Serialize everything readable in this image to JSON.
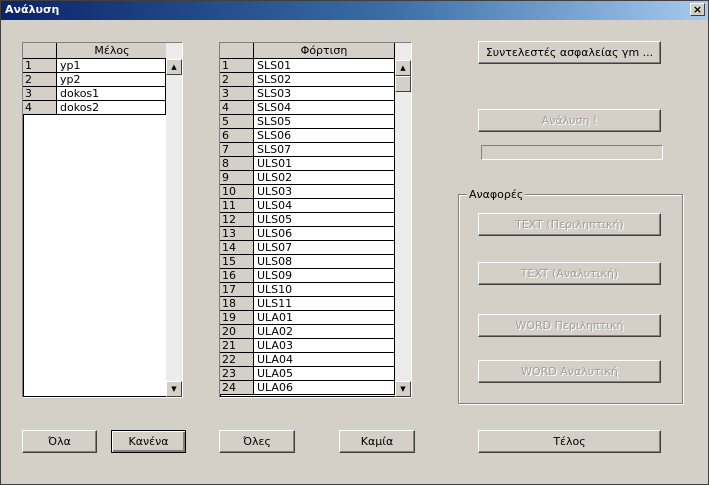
{
  "window": {
    "title": "Ανάλυση",
    "close_label": "×"
  },
  "members": {
    "header": "Μέλος",
    "rows": [
      {
        "num": "1",
        "name": "yp1"
      },
      {
        "num": "2",
        "name": "yp2"
      },
      {
        "num": "3",
        "name": "dokos1"
      },
      {
        "num": "4",
        "name": "dokos2"
      }
    ],
    "btn_all": "Όλα",
    "btn_none": "Κανένα"
  },
  "loads": {
    "header": "Φόρτιση",
    "rows": [
      {
        "num": "1",
        "name": "SLS01"
      },
      {
        "num": "2",
        "name": "SLS02"
      },
      {
        "num": "3",
        "name": "SLS03"
      },
      {
        "num": "4",
        "name": "SLS04"
      },
      {
        "num": "5",
        "name": "SLS05"
      },
      {
        "num": "6",
        "name": "SLS06"
      },
      {
        "num": "7",
        "name": "SLS07"
      },
      {
        "num": "8",
        "name": "ULS01"
      },
      {
        "num": "9",
        "name": "ULS02"
      },
      {
        "num": "10",
        "name": "ULS03"
      },
      {
        "num": "11",
        "name": "ULS04"
      },
      {
        "num": "12",
        "name": "ULS05"
      },
      {
        "num": "13",
        "name": "ULS06"
      },
      {
        "num": "14",
        "name": "ULS07"
      },
      {
        "num": "15",
        "name": "ULS08"
      },
      {
        "num": "16",
        "name": "ULS09"
      },
      {
        "num": "17",
        "name": "ULS10"
      },
      {
        "num": "18",
        "name": "ULS11"
      },
      {
        "num": "19",
        "name": "ULA01"
      },
      {
        "num": "20",
        "name": "ULA02"
      },
      {
        "num": "21",
        "name": "ULA03"
      },
      {
        "num": "22",
        "name": "ULA04"
      },
      {
        "num": "23",
        "name": "ULA05"
      },
      {
        "num": "24",
        "name": "ULA06"
      }
    ],
    "btn_all": "Όλες",
    "btn_none": "Καμία"
  },
  "right": {
    "safety_factors": "Συντελεστές ασφαλείας γm ...",
    "analysis": "Ανάλυση !",
    "reports_title": "Αναφορές",
    "reports": [
      "TEXT (Περιληπτική)",
      "TEXT (Αναλυτική)",
      "WORD Περιληπτική",
      "WORD Αναλυτική"
    ],
    "finish": "Τέλος"
  }
}
